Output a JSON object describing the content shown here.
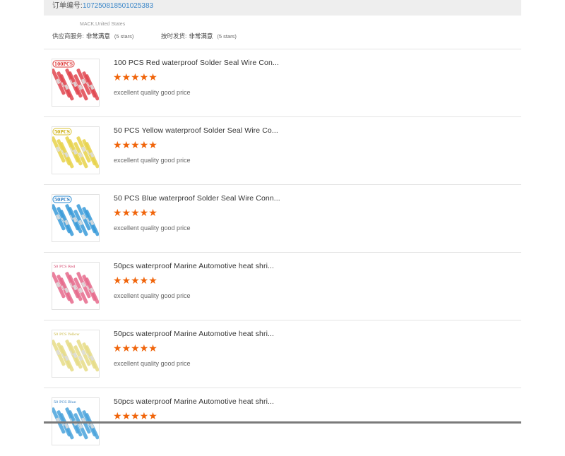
{
  "order": {
    "label": "订单编号:",
    "number": "107250818501025383"
  },
  "buyer": "MACK,United States",
  "ratings": [
    {
      "label": "供应商服务:",
      "value": "非常满意",
      "note": "(5 stars)"
    },
    {
      "label": "按时发货:",
      "value": "非常满意",
      "note": "(5 stars)"
    }
  ],
  "items": [
    {
      "title": "100 PCS Red waterproof Solder Seal Wire Con...",
      "stars": "★★★★★",
      "rating": 5,
      "comment": "excellent quality good price",
      "thumb_color": "#e0454f",
      "badge": "100PCS"
    },
    {
      "title": "50 PCS Yellow waterproof Solder Seal Wire Co...",
      "stars": "★★★★★",
      "rating": 5,
      "comment": "excellent quality good price",
      "thumb_color": "#e8d24a",
      "badge": "50PCS"
    },
    {
      "title": "50 PCS Blue waterproof Solder Seal Wire Conn...",
      "stars": "★★★★★",
      "rating": 5,
      "comment": "excellent quality good price",
      "thumb_color": "#3a9bd9",
      "badge": "50PCS"
    },
    {
      "title": "50pcs waterproof Marine Automotive heat shri...",
      "stars": "★★★★★",
      "rating": 5,
      "comment": "excellent quality good price",
      "thumb_color": "#e66a8c",
      "badge": "50 PCS Red"
    },
    {
      "title": "50pcs waterproof Marine Automotive heat shri...",
      "stars": "★★★★★",
      "rating": 5,
      "comment": "excellent quality good price",
      "thumb_color": "#e6dc86",
      "badge": "50 PCS Yellow"
    },
    {
      "title": "50pcs waterproof Marine Automotive heat shri...",
      "stars": "★★★★★",
      "rating": 5,
      "comment": "",
      "thumb_color": "#4aa3dc",
      "badge": "50 PCS Blue"
    }
  ]
}
